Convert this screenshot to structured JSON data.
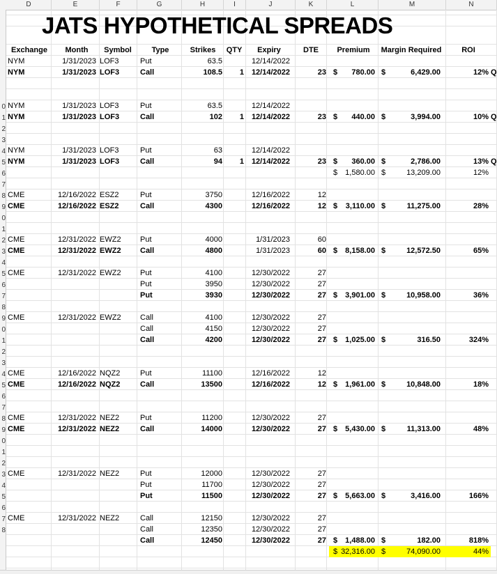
{
  "title": "JATS HYPOTHETICAL SPREADS",
  "columns": [
    "D",
    "E",
    "F",
    "G",
    "H",
    "I",
    "J",
    "K",
    "L",
    "M",
    "N"
  ],
  "row_numbers": [
    "",
    "",
    "",
    "",
    "",
    "",
    "",
    "",
    "",
    "0",
    "1",
    "2",
    "3",
    "4",
    "5",
    "6",
    "7",
    "8",
    "9",
    "0",
    "1",
    "2",
    "3",
    "4",
    "5",
    "6",
    "7",
    "8",
    "9",
    "0",
    "1",
    "2",
    "3",
    "4",
    "5",
    "6",
    "7",
    "8",
    "9",
    "0",
    "1",
    "2",
    "3",
    "4",
    "5",
    "6",
    "7",
    "8"
  ],
  "headers": {
    "exchange": "Exchange",
    "month": "Month",
    "symbol": "Symbol",
    "type": "Type",
    "strikes": "Strikes",
    "qty": "QTY",
    "expiry": "Expiry",
    "dte": "DTE",
    "premium": "Premium",
    "margin": "Margin Required",
    "roi": "ROI"
  },
  "rows": [
    {
      "r": 4,
      "exchange": "NYM",
      "month": "1/31/2023",
      "symbol": "LOF3",
      "type": "Put",
      "strike": "63.5",
      "qty": "",
      "expiry": "12/14/2022",
      "dte": "",
      "premium": "",
      "margin": "",
      "roi": "",
      "bold": false
    },
    {
      "r": 5,
      "exchange": "NYM",
      "month": "1/31/2023",
      "symbol": "LOF3",
      "type": "Call",
      "strike": "108.5",
      "qty": "1",
      "expiry": "12/14/2022",
      "dte": "23",
      "premium": "780.00",
      "margin": "6,429.00",
      "roi": "12%",
      "extra": "Q",
      "bold": true
    },
    {
      "r": 8,
      "exchange": "NYM",
      "month": "1/31/2023",
      "symbol": "LOF3",
      "type": "Put",
      "strike": "63.5",
      "qty": "",
      "expiry": "12/14/2022",
      "dte": "",
      "premium": "",
      "margin": "",
      "roi": "",
      "bold": false
    },
    {
      "r": 9,
      "exchange": "NYM",
      "month": "1/31/2023",
      "symbol": "LOF3",
      "type": "Call",
      "strike": "102",
      "qty": "1",
      "expiry": "12/14/2022",
      "dte": "23",
      "premium": "440.00",
      "margin": "3,994.00",
      "roi": "10%",
      "extra": "Q",
      "bold": true
    },
    {
      "r": 12,
      "exchange": "NYM",
      "month": "1/31/2023",
      "symbol": "LOF3",
      "type": "Put",
      "strike": "63",
      "qty": "",
      "expiry": "12/14/2022",
      "dte": "",
      "premium": "",
      "margin": "",
      "roi": "",
      "bold": false
    },
    {
      "r": 13,
      "exchange": "NYM",
      "month": "1/31/2023",
      "symbol": "LOF3",
      "type": "Call",
      "strike": "94",
      "qty": "1",
      "expiry": "12/14/2022",
      "dte": "23",
      "premium": "360.00",
      "margin": "2,786.00",
      "roi": "13%",
      "extra": "Q",
      "bold": true
    },
    {
      "r": 14,
      "exchange": "",
      "month": "",
      "symbol": "",
      "type": "",
      "strike": "",
      "qty": "",
      "expiry": "",
      "dte": "",
      "premium": "1,580.00",
      "margin": "13,209.00",
      "roi": "12%",
      "bold": false
    },
    {
      "r": 16,
      "exchange": "CME",
      "month": "12/16/2022",
      "symbol": "ESZ2",
      "type": "Put",
      "strike": "3750",
      "qty": "",
      "expiry": "12/16/2022",
      "dte": "12",
      "premium": "",
      "margin": "",
      "roi": "",
      "bold": false
    },
    {
      "r": 17,
      "exchange": "CME",
      "month": "12/16/2022",
      "symbol": "ESZ2",
      "type": "Call",
      "strike": "4300",
      "qty": "",
      "expiry": "12/16/2022",
      "dte": "12",
      "premium": "3,110.00",
      "margin": "11,275.00",
      "roi": "28%",
      "bold": true
    },
    {
      "r": 20,
      "exchange": "CME",
      "month": "12/31/2022",
      "symbol": "EWZ2",
      "type": "Put",
      "strike": "4000",
      "qty": "",
      "expiry": "1/31/2023",
      "dte": "60",
      "premium": "",
      "margin": "",
      "roi": "",
      "bold": false
    },
    {
      "r": 21,
      "exchange": "CME",
      "month": "12/31/2022",
      "symbol": "EWZ2",
      "type": "Call",
      "strike": "4800",
      "qty": "",
      "expiry": "1/31/2023",
      "dte": "60",
      "premium": "8,158.00",
      "margin": "12,572.50",
      "roi": "65%",
      "bold": true,
      "expiry_normal": true
    },
    {
      "r": 23,
      "exchange": "CME",
      "month": "12/31/2022",
      "symbol": "EWZ2",
      "type": "Put",
      "strike": "4100",
      "qty": "",
      "expiry": "12/30/2022",
      "dte": "27",
      "premium": "",
      "margin": "",
      "roi": "",
      "bold": false
    },
    {
      "r": 24,
      "exchange": "",
      "month": "",
      "symbol": "",
      "type": "Put",
      "strike": "3950",
      "qty": "",
      "expiry": "12/30/2022",
      "dte": "27",
      "premium": "",
      "margin": "",
      "roi": "",
      "bold": false
    },
    {
      "r": 25,
      "exchange": "",
      "month": "",
      "symbol": "",
      "type": "Put",
      "strike": "3930",
      "qty": "",
      "expiry": "12/30/2022",
      "dte": "27",
      "premium": "3,901.00",
      "margin": "10,958.00",
      "roi": "36%",
      "bold": true
    },
    {
      "r": 27,
      "exchange": "CME",
      "month": "12/31/2022",
      "symbol": "EWZ2",
      "type": "Call",
      "strike": "4100",
      "qty": "",
      "expiry": "12/30/2022",
      "dte": "27",
      "premium": "",
      "margin": "",
      "roi": "",
      "bold": false
    },
    {
      "r": 28,
      "exchange": "",
      "month": "",
      "symbol": "",
      "type": "Call",
      "strike": "4150",
      "qty": "",
      "expiry": "12/30/2022",
      "dte": "27",
      "premium": "",
      "margin": "",
      "roi": "",
      "bold": false
    },
    {
      "r": 29,
      "exchange": "",
      "month": "",
      "symbol": "",
      "type": "Call",
      "strike": "4200",
      "qty": "",
      "expiry": "12/30/2022",
      "dte": "27",
      "premium": "1,025.00",
      "margin": "316.50",
      "roi": "324%",
      "bold": true
    },
    {
      "r": 32,
      "exchange": "CME",
      "month": "12/16/2022",
      "symbol": "NQZ2",
      "type": "Put",
      "strike": "11100",
      "qty": "",
      "expiry": "12/16/2022",
      "dte": "12",
      "premium": "",
      "margin": "",
      "roi": "",
      "bold": false
    },
    {
      "r": 33,
      "exchange": "CME",
      "month": "12/16/2022",
      "symbol": "NQZ2",
      "type": "Call",
      "strike": "13500",
      "qty": "",
      "expiry": "12/16/2022",
      "dte": "12",
      "premium": "1,961.00",
      "margin": "10,848.00",
      "roi": "18%",
      "bold": true
    },
    {
      "r": 36,
      "exchange": "CME",
      "month": "12/31/2022",
      "symbol": "NEZ2",
      "type": "Put",
      "strike": "11200",
      "qty": "",
      "expiry": "12/30/2022",
      "dte": "27",
      "premium": "",
      "margin": "",
      "roi": "",
      "bold": false
    },
    {
      "r": 37,
      "exchange": "CME",
      "month": "12/31/2022",
      "symbol": "NEZ2",
      "type": "Call",
      "strike": "14000",
      "qty": "",
      "expiry": "12/30/2022",
      "dte": "27",
      "premium": "5,430.00",
      "margin": "11,313.00",
      "roi": "48%",
      "bold": true
    },
    {
      "r": 41,
      "exchange": "CME",
      "month": "12/31/2022",
      "symbol": "NEZ2",
      "type": "Put",
      "strike": "12000",
      "qty": "",
      "expiry": "12/30/2022",
      "dte": "27",
      "premium": "",
      "margin": "",
      "roi": "",
      "bold": false
    },
    {
      "r": 42,
      "exchange": "",
      "month": "",
      "symbol": "",
      "type": "Put",
      "strike": "11700",
      "qty": "",
      "expiry": "12/30/2022",
      "dte": "27",
      "premium": "",
      "margin": "",
      "roi": "",
      "bold": false
    },
    {
      "r": 43,
      "exchange": "",
      "month": "",
      "symbol": "",
      "type": "Put",
      "strike": "11500",
      "qty": "",
      "expiry": "12/30/2022",
      "dte": "27",
      "premium": "5,663.00",
      "margin": "3,416.00",
      "roi": "166%",
      "bold": true
    },
    {
      "r": 45,
      "exchange": "CME",
      "month": "12/31/2022",
      "symbol": "NEZ2",
      "type": "Call",
      "strike": "12150",
      "qty": "",
      "expiry": "12/30/2022",
      "dte": "27",
      "premium": "",
      "margin": "",
      "roi": "",
      "bold": false
    },
    {
      "r": 46,
      "exchange": "",
      "month": "",
      "symbol": "",
      "type": "Call",
      "strike": "12350",
      "qty": "",
      "expiry": "12/30/2022",
      "dte": "27",
      "premium": "",
      "margin": "",
      "roi": "",
      "bold": false
    },
    {
      "r": 47,
      "exchange": "",
      "month": "",
      "symbol": "",
      "type": "Call",
      "strike": "12450",
      "qty": "",
      "expiry": "12/30/2022",
      "dte": "27",
      "premium": "1,488.00",
      "margin": "182.00",
      "roi": "818%",
      "bold": true
    },
    {
      "r": 48,
      "exchange": "",
      "month": "",
      "symbol": "",
      "type": "",
      "strike": "",
      "qty": "",
      "expiry": "",
      "dte": "",
      "premium": "32,316.00",
      "margin": "74,090.00",
      "roi": "44%",
      "bold": false,
      "highlight": true
    }
  ],
  "currency_symbol": "$",
  "highlight_color": "#ffff00"
}
